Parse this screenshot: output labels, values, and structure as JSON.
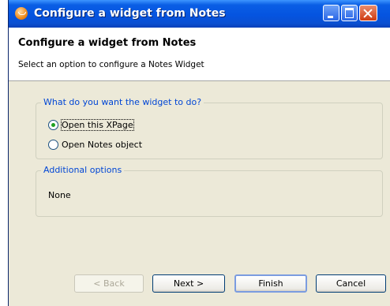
{
  "window": {
    "title": "Configure a widget from Notes"
  },
  "header": {
    "title": "Configure a widget from Notes",
    "subtitle": "Select an option to configure a Notes Widget"
  },
  "action_group": {
    "legend": "What do you want the widget to do?",
    "options": [
      {
        "label": "Open this XPage",
        "selected": true
      },
      {
        "label": "Open Notes object",
        "selected": false
      }
    ]
  },
  "additional_group": {
    "legend": "Additional options",
    "value": "None"
  },
  "buttons": {
    "back": "< Back",
    "next": "Next >",
    "finish": "Finish",
    "cancel": "Cancel"
  },
  "icons": [
    "notes-app-icon",
    "minimize-icon",
    "maximize-icon",
    "close-icon"
  ]
}
